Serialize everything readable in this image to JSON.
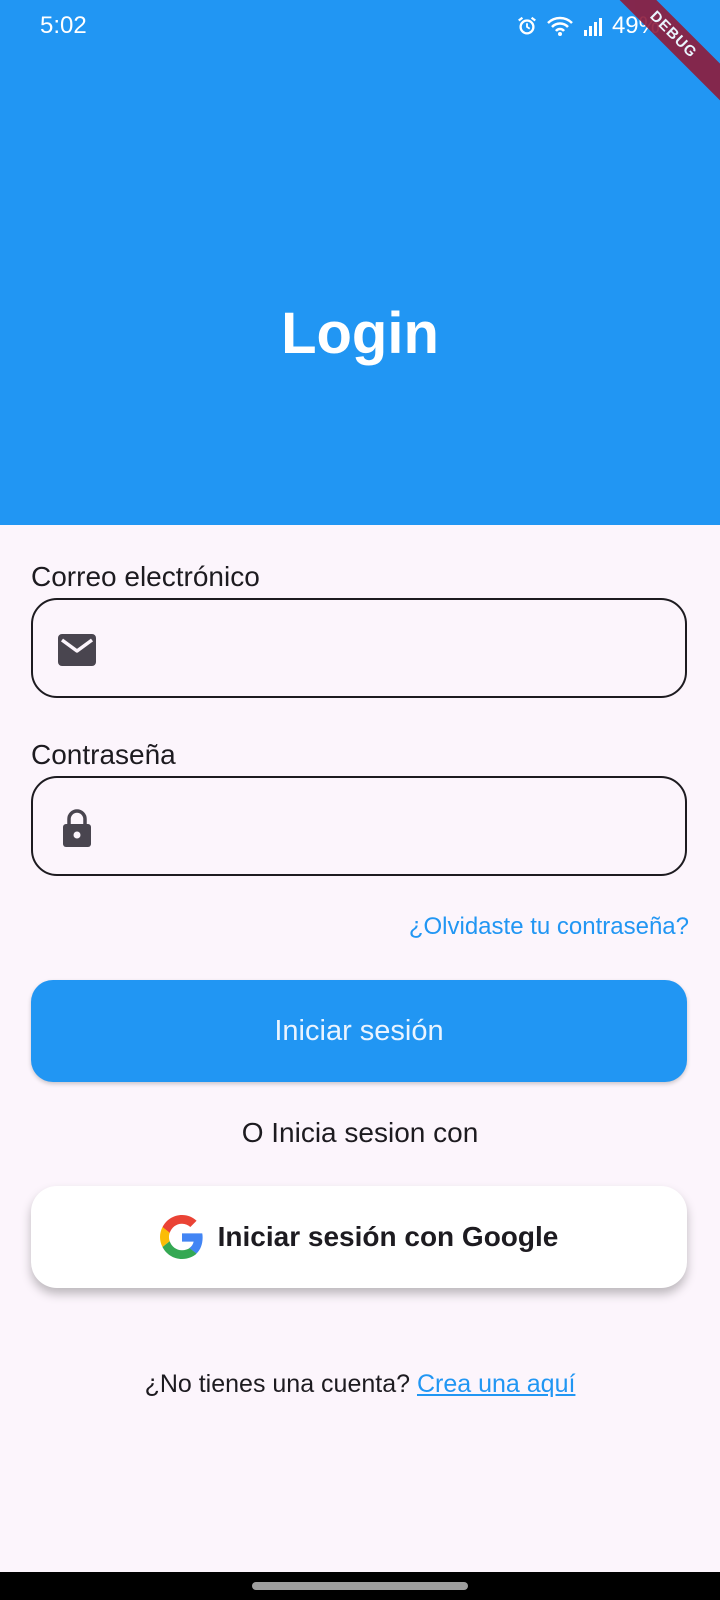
{
  "status_bar": {
    "time": "5:02",
    "battery": "49%"
  },
  "debug_banner": "DEBUG",
  "header": {
    "title": "Login"
  },
  "form": {
    "email_label": "Correo electrónico",
    "email_value": "",
    "password_label": "Contraseña",
    "password_value": "",
    "forgot_link": "¿Olvidaste tu contraseña?",
    "submit_label": "Iniciar sesión",
    "divider_text": "O Inicia sesion con",
    "google_label": "Iniciar sesión con Google"
  },
  "signup": {
    "prompt": "¿No tienes una cuenta?",
    "link": "Crea una aquí"
  },
  "colors": {
    "primary": "#2196f3",
    "background": "#fcf5fc",
    "debug": "#8e1b3b"
  },
  "icons": [
    "alarm-icon",
    "wifi-icon",
    "signal-icon",
    "mail-icon",
    "lock-icon",
    "google-logo-icon"
  ]
}
